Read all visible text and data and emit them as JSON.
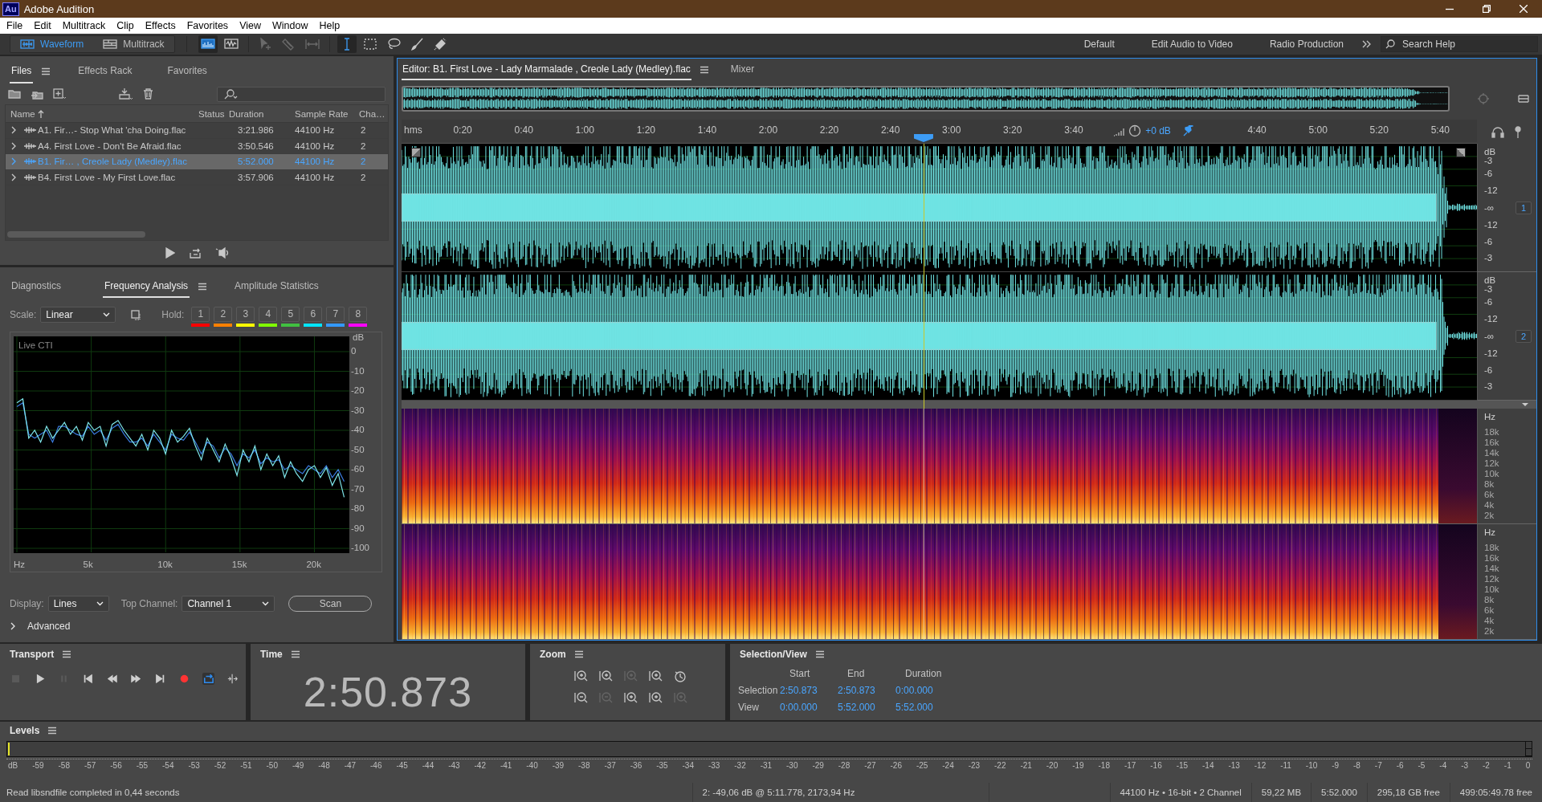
{
  "window": {
    "app_badge": "Au",
    "title": "Adobe Audition"
  },
  "menu": [
    "File",
    "Edit",
    "Multitrack",
    "Clip",
    "Effects",
    "Favorites",
    "View",
    "Window",
    "Help"
  ],
  "toolbar": {
    "modes": [
      {
        "kind": "waveform",
        "label": "Waveform",
        "selected": true
      },
      {
        "kind": "multitrack",
        "label": "Multitrack",
        "selected": false
      }
    ],
    "tools": [
      {
        "kind": "spectral",
        "selected": true,
        "disabled": false
      },
      {
        "kind": "waveform",
        "selected": false,
        "disabled": false
      },
      {
        "kind": "move",
        "selected": false,
        "disabled": true
      },
      {
        "kind": "razor",
        "selected": false,
        "disabled": true
      },
      {
        "kind": "slip",
        "selected": false,
        "disabled": true
      },
      {
        "kind": "time-select",
        "selected": true,
        "disabled": false
      },
      {
        "kind": "marquee",
        "selected": false,
        "disabled": false
      },
      {
        "kind": "lasso",
        "selected": false,
        "disabled": false
      },
      {
        "kind": "brush",
        "selected": false,
        "disabled": false
      },
      {
        "kind": "healing",
        "selected": false,
        "disabled": false
      }
    ],
    "workspaces": [
      "Default",
      "Edit Audio to Video",
      "Radio Production"
    ],
    "search": {
      "placeholder": "Search Help"
    }
  },
  "files": {
    "tabs": [
      {
        "label": "Files",
        "selected": true
      },
      {
        "label": "Effects Rack",
        "selected": false
      },
      {
        "label": "Favorites",
        "selected": false
      }
    ],
    "columns": [
      "Name",
      "Status",
      "Duration",
      "Sample Rate",
      "Cha…"
    ],
    "rows": [
      {
        "name": "A1. Fir…- Stop What 'cha Doing.flac",
        "duration": "3:21.986",
        "sample_rate": "44100 Hz",
        "channels": "2",
        "selected": false,
        "expanded": false
      },
      {
        "name": "A4. First Love - Don't Be Afraid.flac",
        "duration": "3:50.546",
        "sample_rate": "44100 Hz",
        "channels": "2",
        "selected": false,
        "expanded": false
      },
      {
        "name": "B1. Fir… , Creole Lady (Medley).flac",
        "duration": "5:52.000",
        "sample_rate": "44100 Hz",
        "channels": "2",
        "selected": true,
        "expanded": false
      },
      {
        "name": "B4. First Love - My First Love.flac",
        "duration": "3:57.906",
        "sample_rate": "44100 Hz",
        "channels": "2",
        "selected": false,
        "expanded": false
      }
    ]
  },
  "analysis": {
    "tabs": [
      {
        "label": "Diagnostics",
        "selected": false
      },
      {
        "label": "Frequency Analysis",
        "selected": true
      },
      {
        "label": "Amplitude Statistics",
        "selected": false
      }
    ],
    "scale": {
      "label": "Scale:",
      "value": "Linear"
    },
    "hold": {
      "label": "Hold:",
      "buttons": [
        {
          "label": "1",
          "color": "#ff0000"
        },
        {
          "label": "2",
          "color": "#ff8000"
        },
        {
          "label": "3",
          "color": "#ffff00"
        },
        {
          "label": "4",
          "color": "#80ff00"
        },
        {
          "label": "5",
          "color": "#40c040"
        },
        {
          "label": "6",
          "color": "#00e5ff"
        },
        {
          "label": "7",
          "color": "#3399ff"
        },
        {
          "label": "8",
          "color": "#ff00ff"
        }
      ]
    },
    "plot": {
      "caption": "Live CTI",
      "chart_data": {
        "type": "line",
        "ylabel": "dB",
        "x": [
          0,
          400,
          800,
          1200,
          1600,
          2000,
          2400,
          2800,
          3200,
          3600,
          4000,
          4400,
          4800,
          5200,
          5600,
          6000,
          6400,
          6800,
          7200,
          7600,
          8000,
          8400,
          8800,
          9200,
          9600,
          10000,
          10400,
          10800,
          11200,
          11600,
          12000,
          12400,
          12800,
          13200,
          13600,
          14000,
          14400,
          14800,
          15200,
          15600,
          16000,
          16400,
          16800,
          17200,
          17600,
          18000,
          18400,
          18800,
          19200,
          19600,
          20000,
          20400,
          20800,
          21200,
          21600,
          22000
        ],
        "series": [
          {
            "color": "#3a7be0",
            "values": [
              -28,
              -26,
              -42,
              -44,
              -42,
              -40,
              -46,
              -38,
              -38,
              -40,
              -42,
              -43,
              -38,
              -42,
              -40,
              -45,
              -39,
              -37,
              -42,
              -46,
              -46,
              -44,
              -48,
              -42,
              -46,
              -50,
              -42,
              -44,
              -45,
              -41,
              -46,
              -52,
              -46,
              -48,
              -54,
              -49,
              -52,
              -58,
              -52,
              -54,
              -50,
              -57,
              -54,
              -56,
              -55,
              -60,
              -58,
              -60,
              -62,
              -58,
              -60,
              -62,
              -58,
              -64,
              -60,
              -66
            ]
          },
          {
            "color": "#7ee6ea",
            "values": [
              -26,
              -24,
              -44,
              -40,
              -46,
              -38,
              -44,
              -40,
              -36,
              -42,
              -38,
              -45,
              -36,
              -40,
              -38,
              -48,
              -37,
              -35,
              -40,
              -44,
              -48,
              -42,
              -50,
              -40,
              -44,
              -52,
              -40,
              -46,
              -43,
              -39,
              -48,
              -55,
              -44,
              -50,
              -56,
              -47,
              -54,
              -63,
              -50,
              -56,
              -48,
              -60,
              -52,
              -58,
              -53,
              -64,
              -56,
              -62,
              -66,
              -60,
              -58,
              -64,
              -59,
              -68,
              -62,
              -74
            ]
          }
        ],
        "xlim": [
          0,
          22350
        ],
        "ylim": [
          -100,
          0
        ],
        "grid": true,
        "xticks": [
          {
            "value": 0,
            "label": "Hz"
          },
          {
            "value": 5000,
            "label": "5k"
          },
          {
            "value": 10000,
            "label": "10k"
          },
          {
            "value": 15000,
            "label": "15k"
          },
          {
            "value": 20000,
            "label": "20k"
          }
        ],
        "yticks": [
          {
            "value": 0,
            "label": "0"
          },
          {
            "value": -10,
            "label": "-10"
          },
          {
            "value": -20,
            "label": "-20"
          },
          {
            "value": -30,
            "label": "-30"
          },
          {
            "value": -40,
            "label": "-40"
          },
          {
            "value": -50,
            "label": "-50"
          },
          {
            "value": -60,
            "label": "-60"
          },
          {
            "value": -70,
            "label": "-70"
          },
          {
            "value": -80,
            "label": "-80"
          },
          {
            "value": -90,
            "label": "-90"
          },
          {
            "value": -100,
            "label": "-100"
          }
        ]
      }
    },
    "display": {
      "label": "Display:",
      "value": "Lines"
    },
    "top_channel": {
      "label": "Top Channel:",
      "value": "Channel 1"
    },
    "scan_button": "Scan",
    "advanced": {
      "label": "Advanced",
      "expanded": false
    }
  },
  "editor": {
    "tabs": [
      {
        "label": "Editor: B1. First Love - Lady Marmalade , Creole Lady (Medley).flac",
        "selected": true
      },
      {
        "label": "Mixer",
        "selected": false
      }
    ],
    "ruler": [
      {
        "kind": "unit",
        "text": "hms"
      },
      {
        "kind": "time",
        "text": "0:20"
      },
      {
        "kind": "time",
        "text": "0:40"
      },
      {
        "kind": "time",
        "text": "1:00"
      },
      {
        "kind": "time",
        "text": "1:20"
      },
      {
        "kind": "time",
        "text": "1:40"
      },
      {
        "kind": "time",
        "text": "2:00"
      },
      {
        "kind": "time",
        "text": "2:20"
      },
      {
        "kind": "time",
        "text": "2:40"
      },
      {
        "kind": "time",
        "text": "3:00"
      },
      {
        "kind": "time",
        "text": "3:20"
      },
      {
        "kind": "time",
        "text": "3:40"
      },
      {
        "kind": "hud",
        "text": "+0 dB"
      },
      {
        "kind": "time",
        "text": "4:40"
      },
      {
        "kind": "time",
        "text": "5:00"
      },
      {
        "kind": "time",
        "text": "5:20"
      },
      {
        "kind": "time",
        "text": "5:40"
      }
    ],
    "playhead": {
      "level": 0.4854
    },
    "channels": [
      {
        "badge": "1",
        "scale": [
          "dB",
          "-3",
          "-6",
          "-12",
          "-∞",
          "-12",
          "-6",
          "-3"
        ]
      },
      {
        "badge": "2",
        "scale": [
          "dB",
          "-3",
          "-6",
          "-12",
          "-∞",
          "-12",
          "-6",
          "-3"
        ]
      }
    ],
    "spectral": [
      {
        "scale": [
          "Hz",
          "18k",
          "16k",
          "14k",
          "12k",
          "10k",
          "8k",
          "6k",
          "4k",
          "2k"
        ]
      },
      {
        "scale": [
          "Hz",
          "18k",
          "16k",
          "14k",
          "12k",
          "10k",
          "8k",
          "6k",
          "4k",
          "2k"
        ]
      }
    ]
  },
  "transport": {
    "title": "Transport",
    "buttons": [
      {
        "kind": "stop",
        "disabled": true,
        "on": false
      },
      {
        "kind": "play",
        "disabled": false,
        "on": false
      },
      {
        "kind": "pause",
        "disabled": true,
        "on": false
      },
      {
        "kind": "to-start",
        "disabled": false,
        "on": false
      },
      {
        "kind": "rewind",
        "disabled": false,
        "on": false
      },
      {
        "kind": "fast-forward",
        "disabled": false,
        "on": false
      },
      {
        "kind": "to-end",
        "disabled": false,
        "on": false
      },
      {
        "kind": "record",
        "disabled": false,
        "on": false
      },
      {
        "kind": "loop",
        "disabled": false,
        "on": true
      },
      {
        "kind": "skip",
        "disabled": false,
        "on": false
      }
    ]
  },
  "time": {
    "title": "Time",
    "value": "2:50.873"
  },
  "zoom": {
    "title": "Zoom",
    "buttons": [
      {
        "kind": "zoom-in",
        "disabled": false
      },
      {
        "kind": "zoom-in",
        "disabled": false
      },
      {
        "kind": "zoom-in",
        "disabled": true
      },
      {
        "kind": "zoom-in",
        "disabled": false
      },
      {
        "kind": "history",
        "disabled": false
      },
      {
        "kind": "zoom-out",
        "disabled": false
      },
      {
        "kind": "zoom-out",
        "disabled": true
      },
      {
        "kind": "zoom-in",
        "disabled": false
      },
      {
        "kind": "zoom-in",
        "disabled": false
      },
      {
        "kind": "zoom-in",
        "disabled": true
      }
    ]
  },
  "selection_view": {
    "title": "Selection/View",
    "columns": [
      "Start",
      "End",
      "Duration"
    ],
    "rows": [
      {
        "label": "Selection",
        "values": [
          "2:50.873",
          "2:50.873",
          "0:00.000"
        ]
      },
      {
        "label": "View",
        "values": [
          "0:00.000",
          "5:52.000",
          "5:52.000"
        ]
      }
    ]
  },
  "levels": {
    "title": "Levels",
    "scale": [
      "dB",
      "-59",
      "-58",
      "-57",
      "-56",
      "-55",
      "-54",
      "-53",
      "-52",
      "-51",
      "-50",
      "-49",
      "-48",
      "-47",
      "-46",
      "-45",
      "-44",
      "-43",
      "-42",
      "-41",
      "-40",
      "-39",
      "-38",
      "-37",
      "-36",
      "-35",
      "-34",
      "-33",
      "-32",
      "-31",
      "-30",
      "-29",
      "-28",
      "-27",
      "-26",
      "-25",
      "-24",
      "-23",
      "-22",
      "-21",
      "-20",
      "-19",
      "-18",
      "-17",
      "-16",
      "-15",
      "-14",
      "-13",
      "-12",
      "-11",
      "-10",
      "-9",
      "-8",
      "-7",
      "-6",
      "-5",
      "-4",
      "-3",
      "-2",
      "-1",
      "0"
    ]
  },
  "status_bar": {
    "message": "Read libsndfile completed in 0,44 seconds",
    "fields": [
      "2: -49,06 dB @ 5:11.778, 2173,94 Hz",
      "44100 Hz • 16-bit • 2 Channel",
      "59,22 MB",
      "5:52.000",
      "295,18 GB free",
      "499:05:49.78 free"
    ]
  }
}
